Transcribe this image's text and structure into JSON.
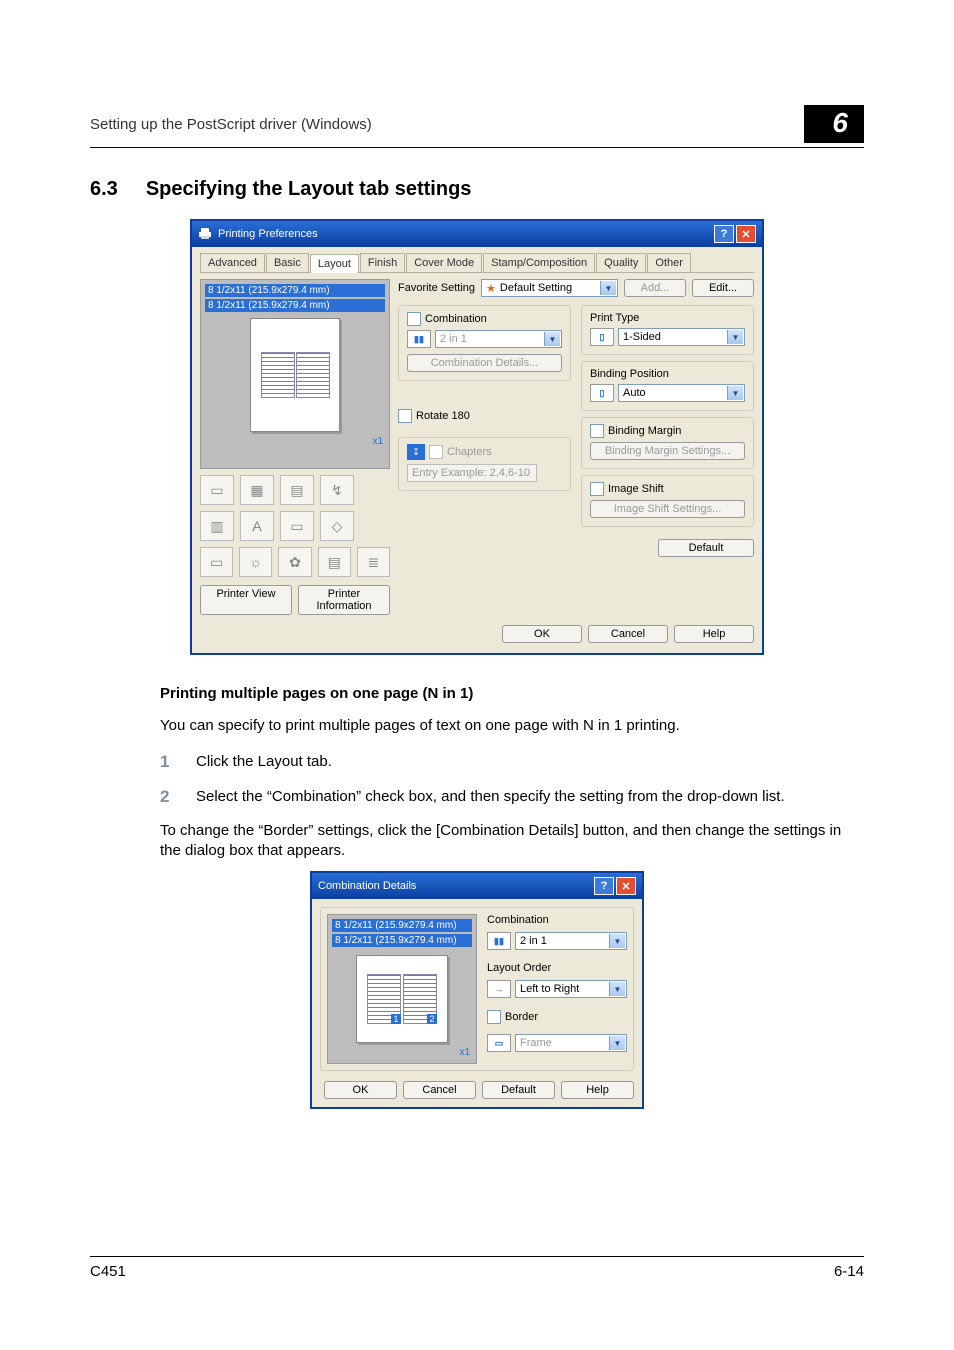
{
  "header": {
    "running": "Setting up the PostScript driver (Windows)",
    "chapter": "6"
  },
  "section": {
    "number": "6.3",
    "title": "Specifying the Layout tab settings"
  },
  "dlg1": {
    "title": "Printing Preferences",
    "tabs": [
      "Advanced",
      "Basic",
      "Layout",
      "Finish",
      "Cover Mode",
      "Stamp/Composition",
      "Quality",
      "Other"
    ],
    "active_tab_index": 2,
    "preview": {
      "line1": "8 1/2x11 (215.9x279.4 mm)",
      "line2": "8 1/2x11 (215.9x279.4 mm)",
      "zoom": "x1"
    },
    "printer_view": "Printer View",
    "printer_info": "Printer Information",
    "favorite": {
      "label": "Favorite Setting",
      "value": "Default Setting",
      "add": "Add...",
      "edit": "Edit..."
    },
    "left_group": {
      "combination_cb": "Combination",
      "combo_value": "2 in 1",
      "combo_details": "Combination Details...",
      "rotate_cb": "Rotate 180",
      "chapters_cb": "Chapters",
      "chapters_hint": "Entry Example: 2,4,6-10"
    },
    "right_group": {
      "print_type_label": "Print Type",
      "print_type_value": "1-Sided",
      "binding_pos_label": "Binding Position",
      "binding_pos_value": "Auto",
      "binding_margin_cb": "Binding Margin",
      "binding_margin_btn": "Binding Margin Settings...",
      "image_shift_cb": "Image Shift",
      "image_shift_btn": "Image Shift Settings..."
    },
    "default_btn": "Default",
    "footer": {
      "ok": "OK",
      "cancel": "Cancel",
      "help": "Help"
    }
  },
  "subhead": "Printing multiple pages on one page (N in 1)",
  "para1": "You can specify to print multiple pages of text on one page with N in 1 printing.",
  "steps": [
    {
      "n": "1",
      "t": "Click the Layout tab."
    },
    {
      "n": "2",
      "t": "Select the “Combination” check box, and then specify the setting from the drop-down list."
    }
  ],
  "para2": "To change the “Border” settings, click the [Combination Details] button, and then change the settings in the dialog box that appears.",
  "dlg2": {
    "title": "Combination Details",
    "preview": {
      "line1": "8 1/2x11 (215.9x279.4 mm)",
      "line2": "8 1/2x11 (215.9x279.4 mm)",
      "zoom": "x1"
    },
    "combination_label": "Combination",
    "combination_value": "2 in 1",
    "layout_order_label": "Layout Order",
    "layout_order_value": "Left to Right",
    "border_cb": "Border",
    "frame_value": "Frame",
    "footer": {
      "ok": "OK",
      "cancel": "Cancel",
      "default": "Default",
      "help": "Help"
    }
  },
  "footer": {
    "left": "C451",
    "right": "6-14"
  }
}
